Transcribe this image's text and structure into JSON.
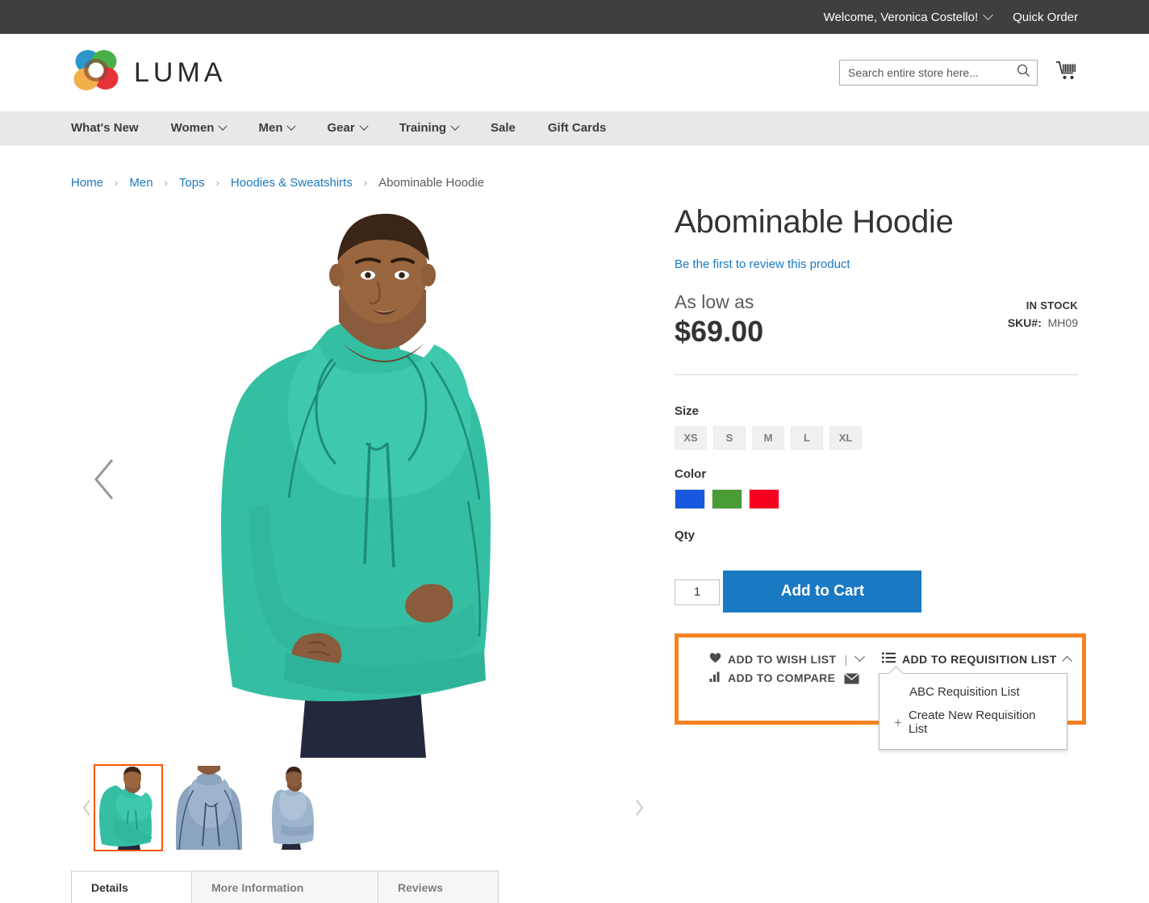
{
  "top_panel": {
    "welcome": "Welcome, Veronica Costello!",
    "account_caret_icon": "chevron-down-icon",
    "quick_order": "Quick Order"
  },
  "header": {
    "logo_text": "LUMA",
    "logo_icon": "luma-flower-logo",
    "search": {
      "placeholder": "Search entire store here...",
      "value": "",
      "icon": "search-icon"
    },
    "cart_icon": "shopping-cart-icon"
  },
  "nav": {
    "items": [
      {
        "label": "What's New",
        "has_caret": false
      },
      {
        "label": "Women",
        "has_caret": true
      },
      {
        "label": "Men",
        "has_caret": true
      },
      {
        "label": "Gear",
        "has_caret": true
      },
      {
        "label": "Training",
        "has_caret": true
      },
      {
        "label": "Sale",
        "has_caret": false
      },
      {
        "label": "Gift Cards",
        "has_caret": false
      }
    ]
  },
  "breadcrumb": {
    "separator": "›",
    "items": [
      {
        "label": "Home",
        "current": false
      },
      {
        "label": "Men",
        "current": false
      },
      {
        "label": "Tops",
        "current": false
      },
      {
        "label": "Hoodies & Sweatshirts",
        "current": false
      },
      {
        "label": "Abominable Hoodie",
        "current": true
      }
    ]
  },
  "gallery": {
    "prev_icon": "chevron-left-icon",
    "next_icon": "chevron-right-icon",
    "thumb_prev_icon": "chevron-left-icon",
    "thumb_next_icon": "chevron-right-icon",
    "thumbnails": [
      {
        "name": "front-green-hoodie",
        "active": true
      },
      {
        "name": "detail-grey-hoodie",
        "active": false
      },
      {
        "name": "back-grey-hoodie",
        "active": false
      }
    ]
  },
  "product": {
    "title": "Abominable Hoodie",
    "review_link": "Be the first to review this product",
    "as_low_as": "As low as",
    "price": "$69.00",
    "stock_status": "IN STOCK",
    "sku_label": "SKU#:",
    "sku_value": "MH09",
    "size_label": "Size",
    "sizes": [
      "XS",
      "S",
      "M",
      "L",
      "XL"
    ],
    "color_label": "Color",
    "colors": [
      {
        "name": "blue",
        "hex": "#1857e0"
      },
      {
        "name": "green",
        "hex": "#4a9c35"
      },
      {
        "name": "red",
        "hex": "#fa0020"
      }
    ],
    "qty_label": "Qty",
    "qty_value": "1",
    "add_to_cart": "Add to Cart"
  },
  "product_links": {
    "highlight_color": "#f58220",
    "wish_list": "ADD TO WISH LIST",
    "wish_list_icon": "heart-icon",
    "wish_list_caret_icon": "chevron-down-icon",
    "compare": "ADD TO COMPARE",
    "compare_icon": "bar-chart-icon",
    "email_icon": "envelope-icon",
    "requisition_trigger": "ADD TO REQUISITION LIST",
    "requisition_icon": "list-icon",
    "requisition_caret_icon": "chevron-up-icon",
    "dropdown": {
      "items": [
        {
          "label": "ABC Requisition List",
          "icon": null
        },
        {
          "label": "Create New Requisition List",
          "icon": "plus-icon"
        }
      ]
    }
  },
  "tabs": [
    {
      "label": "Details",
      "active": true
    },
    {
      "label": "More Information",
      "active": false
    },
    {
      "label": "Reviews",
      "active": false
    }
  ]
}
